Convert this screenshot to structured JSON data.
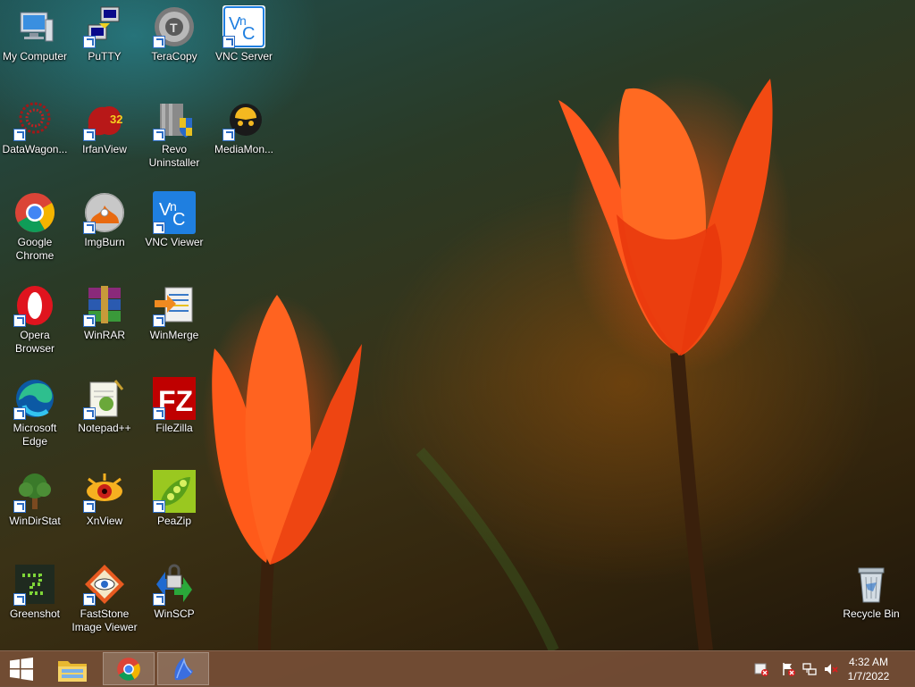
{
  "desktop": {
    "icons": [
      {
        "label": "My Computer",
        "icon": "my-computer-icon"
      },
      {
        "label": "PuTTY",
        "icon": "putty-icon"
      },
      {
        "label": "TeraCopy",
        "icon": "teracopy-icon"
      },
      {
        "label": "VNC Server",
        "icon": "vnc-server-icon"
      },
      {
        "label": "DataWagon...",
        "icon": "datawagon-icon"
      },
      {
        "label": "IrfanView",
        "icon": "irfanview-icon"
      },
      {
        "label": "Revo Uninstaller",
        "icon": "revo-uninstaller-icon"
      },
      {
        "label": "MediaMon...",
        "icon": "mediamonkey-icon"
      },
      {
        "label": "Google Chrome",
        "icon": "chrome-icon"
      },
      {
        "label": "ImgBurn",
        "icon": "imgburn-icon"
      },
      {
        "label": "VNC Viewer",
        "icon": "vnc-viewer-icon"
      },
      {
        "label": "Opera Browser",
        "icon": "opera-icon"
      },
      {
        "label": "WinRAR",
        "icon": "winrar-icon"
      },
      {
        "label": "WinMerge",
        "icon": "winmerge-icon"
      },
      {
        "label": "Microsoft Edge",
        "icon": "edge-icon"
      },
      {
        "label": "Notepad++",
        "icon": "notepadpp-icon"
      },
      {
        "label": "FileZilla",
        "icon": "filezilla-icon"
      },
      {
        "label": "WinDirStat",
        "icon": "windirstat-icon"
      },
      {
        "label": "XnView",
        "icon": "xnview-icon"
      },
      {
        "label": "PeaZip",
        "icon": "peazip-icon"
      },
      {
        "label": "Greenshot",
        "icon": "greenshot-icon"
      },
      {
        "label": "FastStone Image Viewer",
        "icon": "faststone-icon"
      },
      {
        "label": "WinSCP",
        "icon": "winscp-icon"
      },
      {
        "label": "Recycle Bin",
        "icon": "recycle-bin-icon"
      }
    ]
  },
  "taskbar": {
    "start_icon": "windows-logo-icon",
    "pinned": [
      {
        "name": "file-explorer",
        "icon": "folder-icon"
      },
      {
        "name": "chrome",
        "icon": "chrome-icon"
      },
      {
        "name": "bluebird",
        "icon": "bird-icon"
      }
    ],
    "tray": {
      "time": "4:32 AM",
      "date": "1/7/2022"
    }
  }
}
